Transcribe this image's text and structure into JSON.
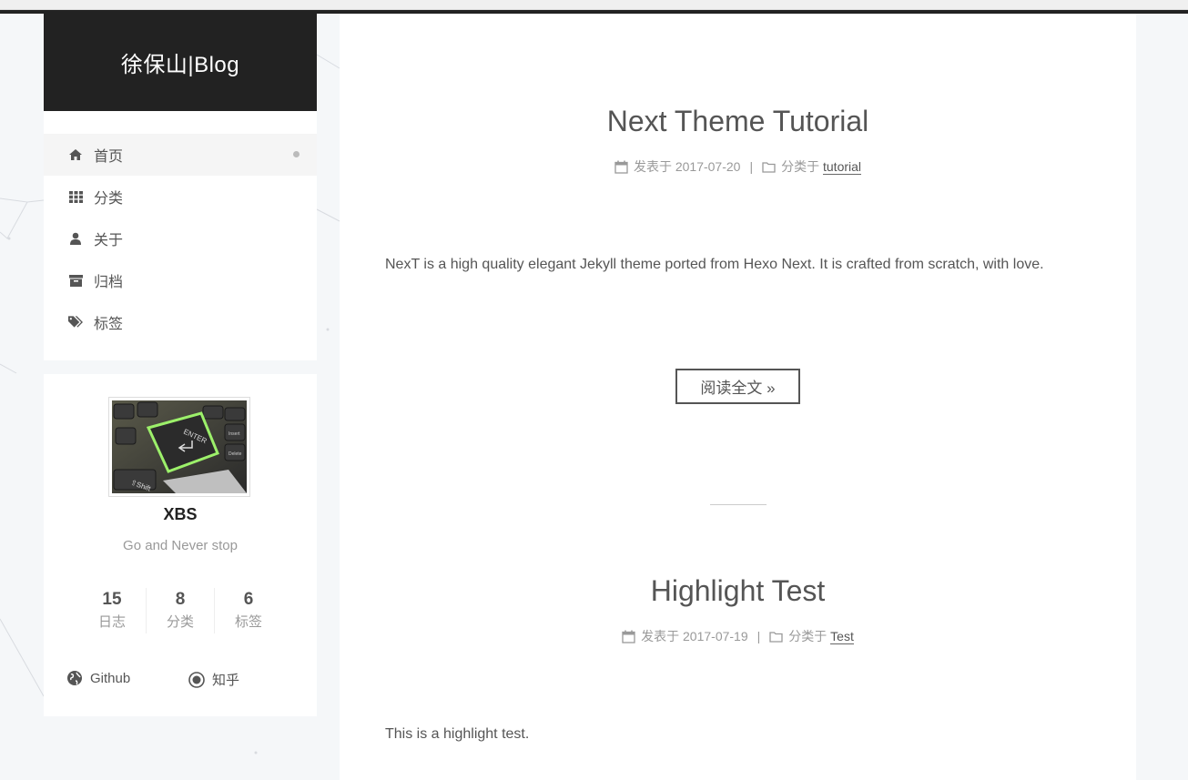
{
  "site": {
    "title": "徐保山|Blog"
  },
  "menu": {
    "items": [
      {
        "label": "首页",
        "icon": "home-icon",
        "active": true
      },
      {
        "label": "分类",
        "icon": "th-icon"
      },
      {
        "label": "关于",
        "icon": "user-icon"
      },
      {
        "label": "归档",
        "icon": "archive-icon"
      },
      {
        "label": "标签",
        "icon": "tags-icon"
      }
    ]
  },
  "profile": {
    "author": "XBS",
    "motto": "Go and Never stop",
    "stats": [
      {
        "count": "15",
        "label": "日志"
      },
      {
        "count": "8",
        "label": "分类"
      },
      {
        "count": "6",
        "label": "标签"
      }
    ],
    "links": [
      {
        "label": "Github",
        "icon": "globe-icon"
      },
      {
        "label": "知乎",
        "icon": "circle-dot-icon"
      }
    ]
  },
  "posts": [
    {
      "title": "Next Theme Tutorial",
      "posted_label": "发表于",
      "date": "2017-07-20",
      "category_label": "分类于",
      "category": "tutorial",
      "excerpt": "NexT is a high quality elegant Jekyll theme ported from Hexo Next. It is crafted from scratch, with love.",
      "read_more": "阅读全文 »"
    },
    {
      "title": "Highlight Test",
      "posted_label": "发表于",
      "date": "2017-07-19",
      "category_label": "分类于",
      "category": "Test",
      "excerpt": "This is a highlight test."
    }
  ],
  "colors": {
    "brand_bg": "#222222",
    "page_bg": "#f5f7f9",
    "text": "#555555"
  }
}
